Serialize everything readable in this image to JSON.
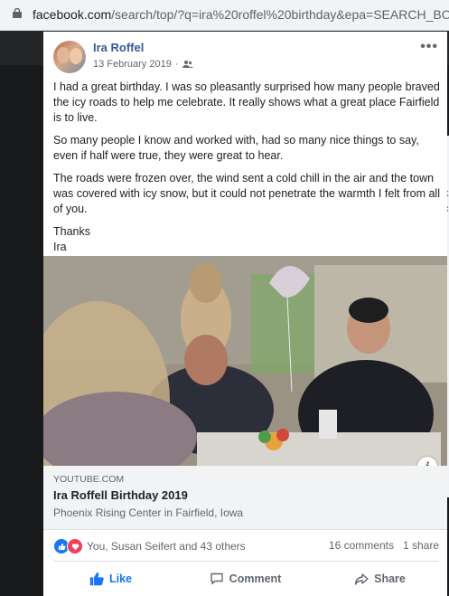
{
  "browser": {
    "url": "facebook.com/search/top/?q=ira%20roffel%20birthday&epa=SEARCH_BO",
    "url_host": "facebook.com",
    "url_path": "/search/top/?q=ira%20roffel%20birthday&epa=SEARCH_BO"
  },
  "right_peek": {
    "chars": [
      "k",
      "c",
      "r",
      "r"
    ]
  },
  "post": {
    "author": "Ira Roffel",
    "date": "13 February 2019",
    "audience_icon": "friends-icon",
    "more_label": "•••",
    "paragraphs": [
      "I had a great birthday. I was so pleasantly surprised how many people braved the icy roads to help me celebrate. It really shows what a great place Fairfield is to live.",
      "So many people I know and worked with, had so many nice things to say, even if half were true, they were great to hear.",
      "The roads were frozen over, the wind sent a cold chill in the air and the town was covered with icy snow, but it could not penetrate the warmth I felt from all of you."
    ],
    "closing_line1": "Thanks",
    "closing_line2": "Ira",
    "link": {
      "source": "YOUTUBE.COM",
      "title": "Ira Roffell Birthday 2019",
      "subtitle": "Phoenix Rising Center in Fairfield, Iowa"
    },
    "info_label": "i",
    "reactions": {
      "types": [
        "like",
        "love"
      ],
      "names": "You, Susan Seifert and 43 others"
    },
    "comments": "16 comments",
    "shares": "1 share",
    "actions": {
      "like": "Like",
      "comment": "Comment",
      "share": "Share"
    },
    "colors": {
      "link_blue": "#385898",
      "fb_blue": "#1877f2",
      "love_red": "#f33e58"
    }
  }
}
